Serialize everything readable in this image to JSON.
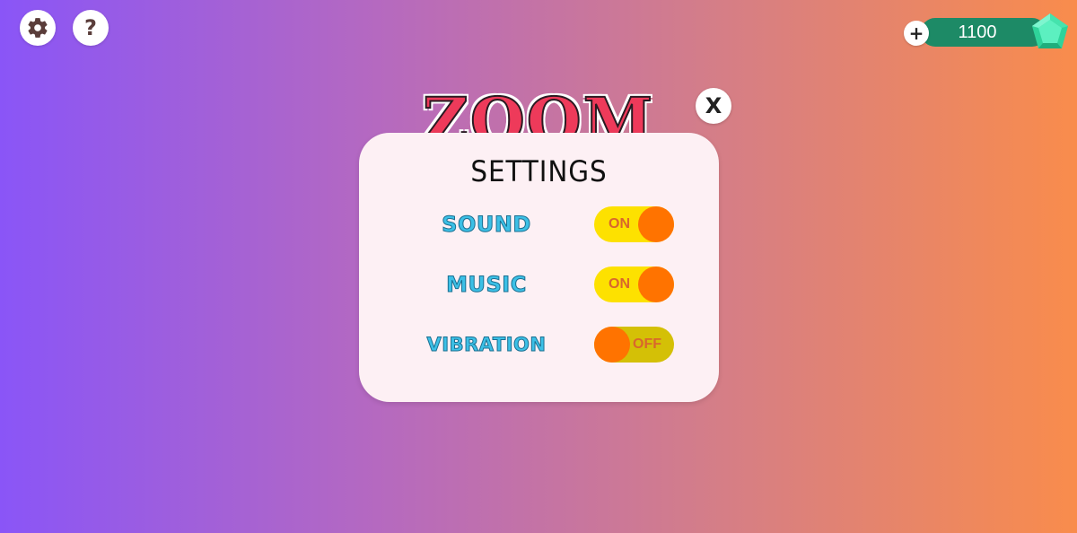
{
  "topbar": {
    "settings_icon": "gear-icon",
    "help_glyph": "?",
    "currency": {
      "plus_label": "+",
      "amount": "1100",
      "icon": "gem-icon",
      "pill_color": "#1d8a66",
      "gem_color": "#3ee6a8"
    }
  },
  "logo": {
    "text": "ZOOM IT"
  },
  "settings_panel": {
    "title": "SETTINGS",
    "close_label": "X",
    "rows": [
      {
        "label": "SOUND",
        "state": "ON"
      },
      {
        "label": "MUSIC",
        "state": "ON"
      },
      {
        "label": "VIBRATION",
        "state": "OFF"
      }
    ]
  },
  "colors": {
    "background_start": "#8a55f7",
    "background_end": "#f98c4c",
    "panel": "#fdf0f4",
    "label": "#3cc0e6",
    "toggle_track_on": "#fde100",
    "toggle_track_off": "#d4c006",
    "toggle_knob": "#ff7300"
  }
}
